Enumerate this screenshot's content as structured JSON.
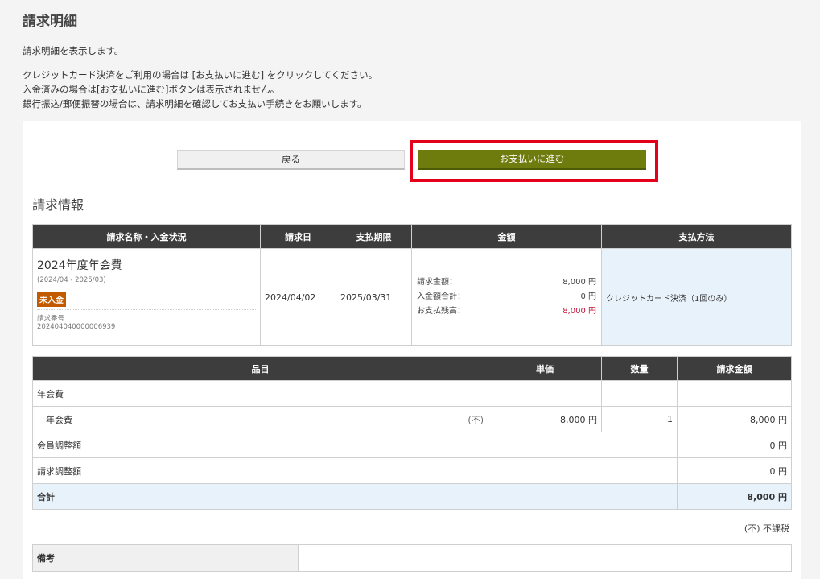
{
  "page": {
    "title": "請求明細",
    "desc1": "請求明細を表示します。",
    "desc2": "クレジットカード決済をご利用の場合は [お支払いに進む] をクリックしてください。",
    "desc3": "入金済みの場合は[お支払いに進む]ボタンは表示されません。",
    "desc4": "銀行振込/郵便振替の場合は、請求明細を確認してお支払い手続きをお願いします。"
  },
  "buttons": {
    "back": "戻る",
    "pay": "お支払いに進む"
  },
  "billing": {
    "section_title": "請求情報",
    "headers": {
      "name_status": "請求名称・入金状況",
      "date": "請求日",
      "due": "支払期限",
      "amount": "金額",
      "method": "支払方法"
    },
    "name": "2024年度年会費",
    "period": "(2024/04 - 2025/03)",
    "status": "未入金",
    "invoice_no_label": "請求番号",
    "invoice_no": "202404040000006939",
    "date": "2024/04/02",
    "due": "2025/03/31",
    "amount_label_billed": "請求金額：",
    "amount_billed": "8,000 円",
    "amount_label_paid": "入金額合計：",
    "amount_paid": "0 円",
    "amount_label_balance": "お支払残高：",
    "amount_balance": "8,000 円",
    "method": "クレジットカード決済（1回のみ）",
    "colors": {
      "status_badge": "#c25a00",
      "balance": "#c0193a",
      "method_bg": "#e8f2fb"
    }
  },
  "items": {
    "headers": {
      "item": "品目",
      "unit_price": "単価",
      "qty": "数量",
      "billed": "請求金額"
    },
    "group": "年会費",
    "row": {
      "name": "年会費",
      "tax_mark": "(不)",
      "unit_price": "8,000 円",
      "qty": "1",
      "billed": "8,000 円"
    },
    "member_adj_label": "会員調整額",
    "member_adj": "0 円",
    "invoice_adj_label": "請求調整額",
    "invoice_adj": "0 円",
    "total_label": "合計",
    "total": "8,000 円",
    "tax_note": "(不) 不課税"
  },
  "remarks": {
    "label": "備考",
    "value": ""
  }
}
